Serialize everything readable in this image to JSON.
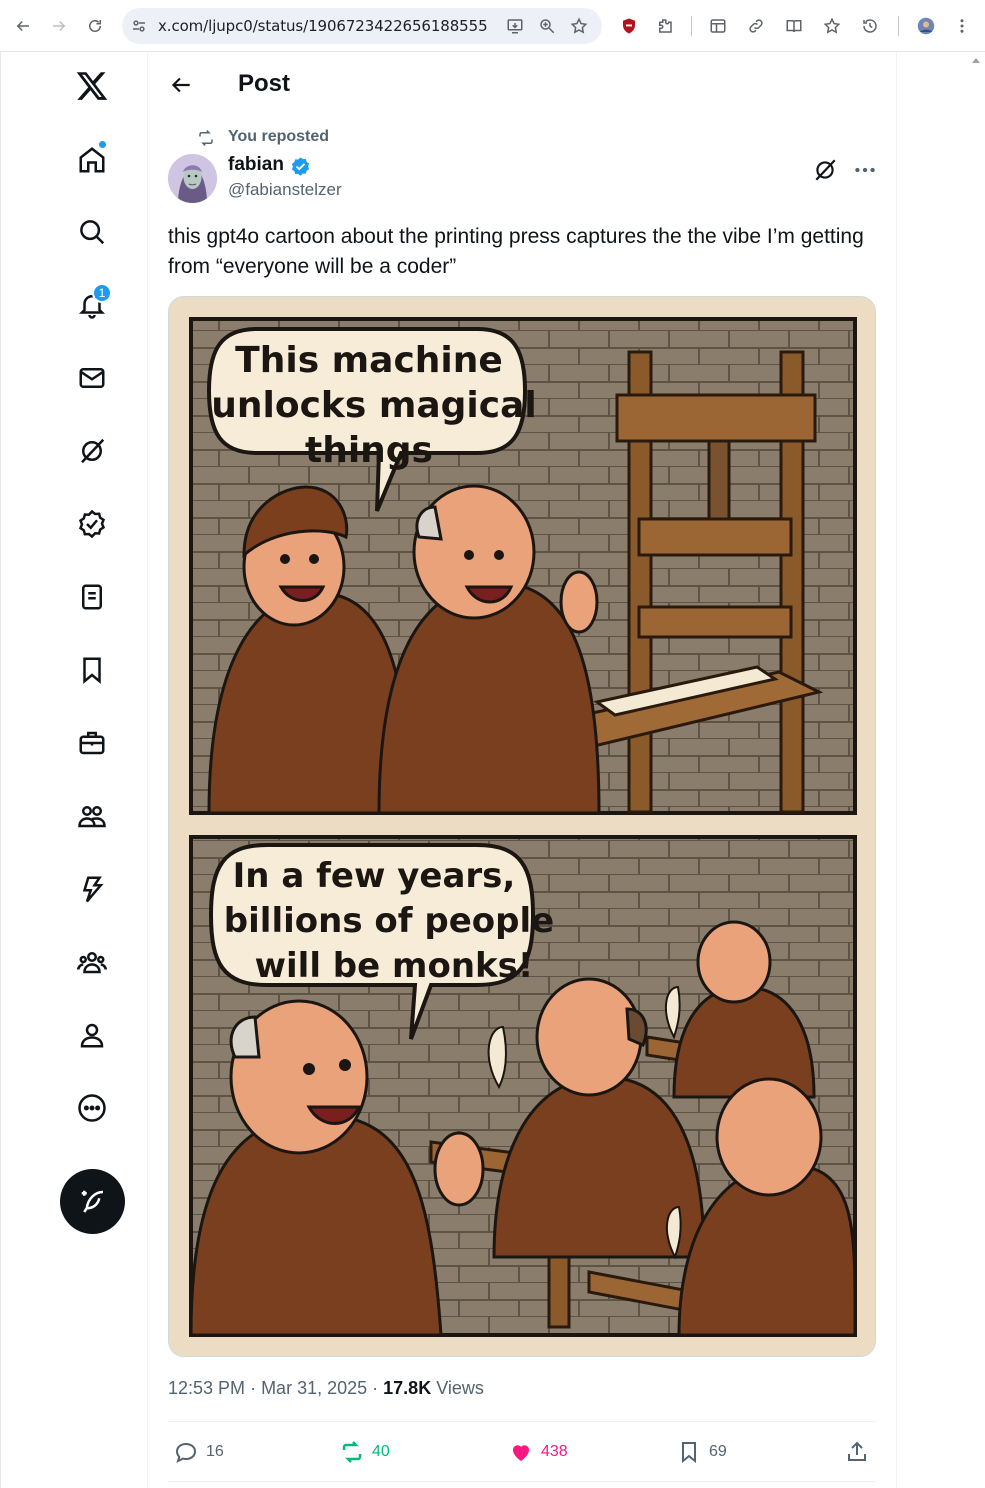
{
  "browser": {
    "url": "x.com/ljupc0/status/1906723422656188555"
  },
  "nav": {
    "notifications_badge": "1"
  },
  "header": {
    "title": "Post"
  },
  "post": {
    "repost_label": "You reposted",
    "author_name": "fabian",
    "author_handle": "@fabianstelzer",
    "text": "this gpt4o cartoon about the printing press captures the the vibe I’m getting from “everyone will be a coder”",
    "image": {
      "panel1_caption": [
        "This machine",
        "unlocks magical",
        "things"
      ],
      "panel2_caption": [
        "In a few years,",
        "billions of people",
        "will be monks!"
      ]
    },
    "time": "12:53 PM",
    "date": "Mar 31, 2025",
    "views_count": "17.8K",
    "views_label": "Views",
    "replies": "16",
    "reposts": "40",
    "likes": "438",
    "bookmarks": "69"
  },
  "colors": {
    "accent": "#1d9bf0",
    "repost_green": "#00ba7c",
    "like_pink": "#f91880"
  }
}
